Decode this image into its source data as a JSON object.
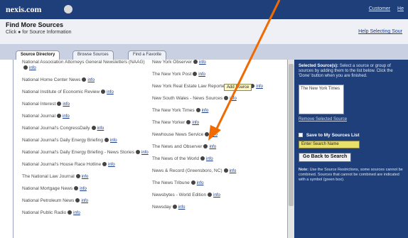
{
  "header": {
    "brand": "nexis.com",
    "brand_sub": "",
    "links": [
      "Customer",
      "He"
    ]
  },
  "title": {
    "heading": "Find More Sources",
    "subheading": "Click ● for Source Information",
    "help": "Help Selecting Sour"
  },
  "tabs": [
    {
      "label": "Source Directory"
    },
    {
      "label": "Browse Sources"
    },
    {
      "label": "Find a Favorite"
    }
  ],
  "sources_left": [
    {
      "title": "National Association Attorneys General Newsletters (NAAG)",
      "link": "info"
    },
    {
      "title": "National Home Center News",
      "link": "info"
    },
    {
      "title": "National Institute of Economic Review",
      "link": "info"
    },
    {
      "title": "National Interest",
      "link": "info"
    },
    {
      "title": "National Journal",
      "link": "info"
    },
    {
      "title": "National Journal's CongressDaily",
      "link": "info"
    },
    {
      "title": "National Journal's Daily Energy Briefing",
      "link": "info"
    },
    {
      "title": "National Journal's Daily Energy Briefing - News Stories",
      "link": "info"
    },
    {
      "title": "National Journal's House Race Hotline",
      "link": "info"
    },
    {
      "title": "The National Law Journal",
      "link": "info"
    },
    {
      "title": "National Mortgage News",
      "link": "info"
    },
    {
      "title": "National Petroleum News",
      "link": "info"
    },
    {
      "title": "National Public Radio",
      "link": "info"
    }
  ],
  "sources_right": [
    {
      "title": "New York Observer",
      "link": "info"
    },
    {
      "title": "The New York Post",
      "link": "info"
    },
    {
      "title": "New York Real Estate Law Reporter Newsletter",
      "link": "info"
    },
    {
      "title": "New South Wales - News Sources",
      "link": "info"
    },
    {
      "title": "The New York Times",
      "link": "info"
    },
    {
      "title": "The New Yorker",
      "link": "info"
    },
    {
      "title": "Newhouse News Service",
      "link": "info"
    },
    {
      "title": "The News and Observer",
      "link": "info"
    },
    {
      "title": "The News of the World",
      "link": "info"
    },
    {
      "title": "News & Record (Greensboro, NC)",
      "link": "info"
    },
    {
      "title": "The News Tribune",
      "link": "info"
    },
    {
      "title": "Newsbytes - World Edition",
      "link": "info"
    },
    {
      "title": "Newsday",
      "link": "info"
    }
  ],
  "add_button": "Add Source",
  "side": {
    "instructions_bold": "Selected Source(s):",
    "instructions": "Select a source or group of sources by adding them to the list below. Click the 'Done' button when you are finished.",
    "selected": [
      "The New York Times"
    ],
    "remove": "Remove Selected Source",
    "save_label": "Save to My Sources List",
    "saved_field": "Enter Search Name",
    "search_button": "Go Back to Search",
    "note_bold": "Note:",
    "note": "Use the Source Restrictions, some sources cannot be combined. Sources that cannot be combined are indicated with a symbol (green box)."
  },
  "colors": {
    "navy": "#1f3f7a",
    "arrow": "#f06a00",
    "highlight": "#e9e06a"
  }
}
